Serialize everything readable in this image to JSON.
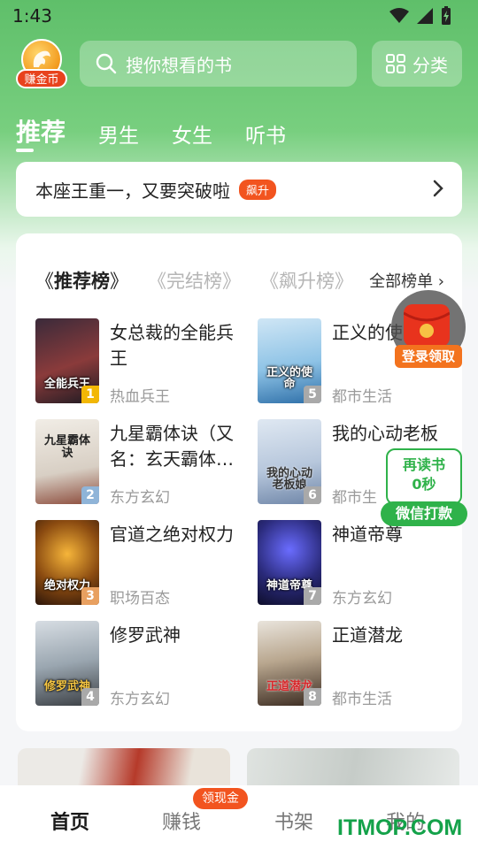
{
  "status_bar": {
    "time": "1:43"
  },
  "header": {
    "coin_label": "赚金币",
    "search_placeholder": "搜你想看的书",
    "category_label": "分类"
  },
  "tabs": [
    {
      "label": "推荐",
      "active": true
    },
    {
      "label": "男生",
      "active": false
    },
    {
      "label": "女生",
      "active": false
    },
    {
      "label": "听书",
      "active": false
    }
  ],
  "notice": {
    "text": "本座王重一，又要突破啦",
    "badge": "飙升"
  },
  "ranking": {
    "tabs": [
      {
        "label": "推荐榜",
        "active": true
      },
      {
        "label": "完结榜",
        "active": false
      },
      {
        "label": "飙升榜",
        "active": false
      }
    ],
    "all_label": "全部榜单 ›",
    "books": [
      {
        "rank": "1",
        "title": "女总裁的全能兵王",
        "genre": "热血兵王",
        "cover_text": "全能兵王"
      },
      {
        "rank": "5",
        "title": "正义的使",
        "genre": "都市生活",
        "cover_text": "正义的使命"
      },
      {
        "rank": "2",
        "title": "九星霸体诀（又名：玄天霸体…",
        "genre": "东方玄幻",
        "cover_text": "九星霸体诀"
      },
      {
        "rank": "6",
        "title": "我的心动老板",
        "genre": "都市生",
        "cover_text": "我的心动老板娘"
      },
      {
        "rank": "3",
        "title": "官道之绝对权力",
        "genre": "职场百态",
        "cover_text": "绝对权力"
      },
      {
        "rank": "7",
        "title": "神道帝尊",
        "genre": "东方玄幻",
        "cover_text": "神道帝尊"
      },
      {
        "rank": "4",
        "title": "修罗武神",
        "genre": "东方玄幻",
        "cover_text": "修罗武神"
      },
      {
        "rank": "8",
        "title": "正道潜龙",
        "genre": "都市生活",
        "cover_text": "正道潜龙"
      }
    ]
  },
  "floating": {
    "login_label": "登录领取",
    "read_line1": "再读书",
    "read_line2": "0秒",
    "wechat_label": "微信打款"
  },
  "bottom_nav": {
    "items": [
      {
        "label": "首页",
        "active": true
      },
      {
        "label": "赚钱",
        "active": false
      },
      {
        "label": "书架",
        "active": false
      },
      {
        "label": "我的",
        "active": false
      }
    ],
    "badge": "领现金"
  },
  "watermark": "ITMOP.COM",
  "colors": {
    "brand_green": "#5fbf6a",
    "accent_orange": "#f2541f",
    "wechat_green": "#2fb24a"
  }
}
